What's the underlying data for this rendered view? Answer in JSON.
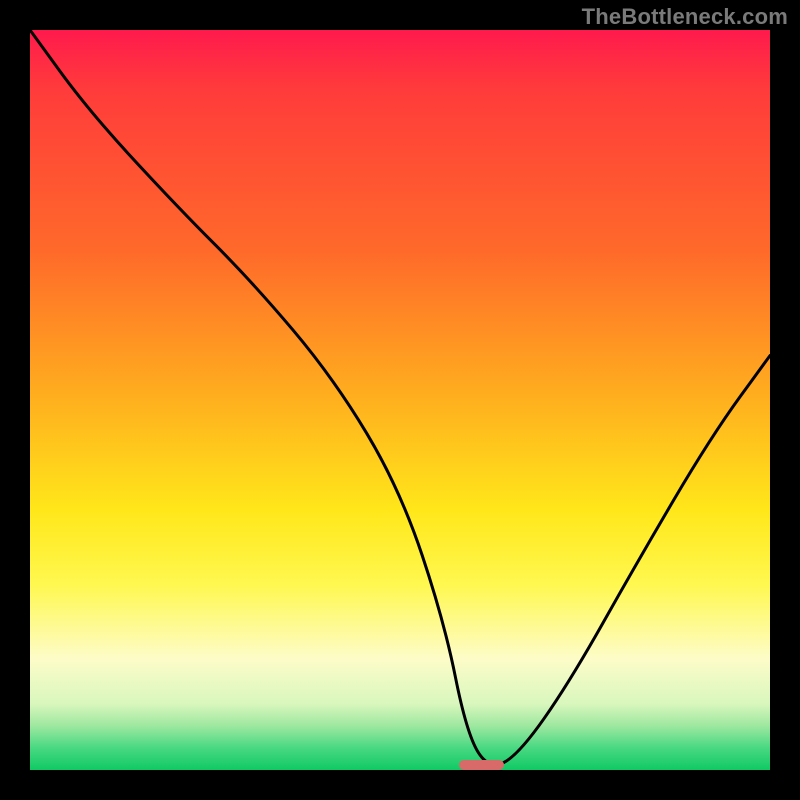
{
  "watermark": "TheBottleneck.com",
  "colors": {
    "background": "#000000",
    "curve": "#000000",
    "marker": "#d86a6a",
    "watermark_text": "#7a7a7a"
  },
  "chart_data": {
    "type": "line",
    "title": "",
    "xlabel": "",
    "ylabel": "",
    "xlim": [
      0,
      100
    ],
    "ylim": [
      0,
      100
    ],
    "grid": false,
    "legend": false,
    "series": [
      {
        "name": "bottleneck-curve",
        "x": [
          0,
          8,
          20,
          30,
          41,
          50,
          56,
          59,
          62,
          66,
          73,
          82,
          92,
          100
        ],
        "values": [
          100,
          89,
          76,
          66,
          53,
          38,
          20,
          5,
          0,
          2,
          12,
          28,
          45,
          56
        ]
      }
    ],
    "marker": {
      "x_center": 61,
      "y": 0,
      "width": 6,
      "height": 1.4
    },
    "gradient_stops": [
      {
        "pos": 0,
        "color": "#ff1a4d"
      },
      {
        "pos": 8,
        "color": "#ff3b3b"
      },
      {
        "pos": 30,
        "color": "#ff6a2a"
      },
      {
        "pos": 50,
        "color": "#ffb01e"
      },
      {
        "pos": 65,
        "color": "#ffe71a"
      },
      {
        "pos": 75,
        "color": "#fff850"
      },
      {
        "pos": 85,
        "color": "#fdfcc8"
      },
      {
        "pos": 91,
        "color": "#d9f7be"
      },
      {
        "pos": 94,
        "color": "#9ee8a0"
      },
      {
        "pos": 97,
        "color": "#49d882"
      },
      {
        "pos": 100,
        "color": "#0fca64"
      }
    ]
  }
}
